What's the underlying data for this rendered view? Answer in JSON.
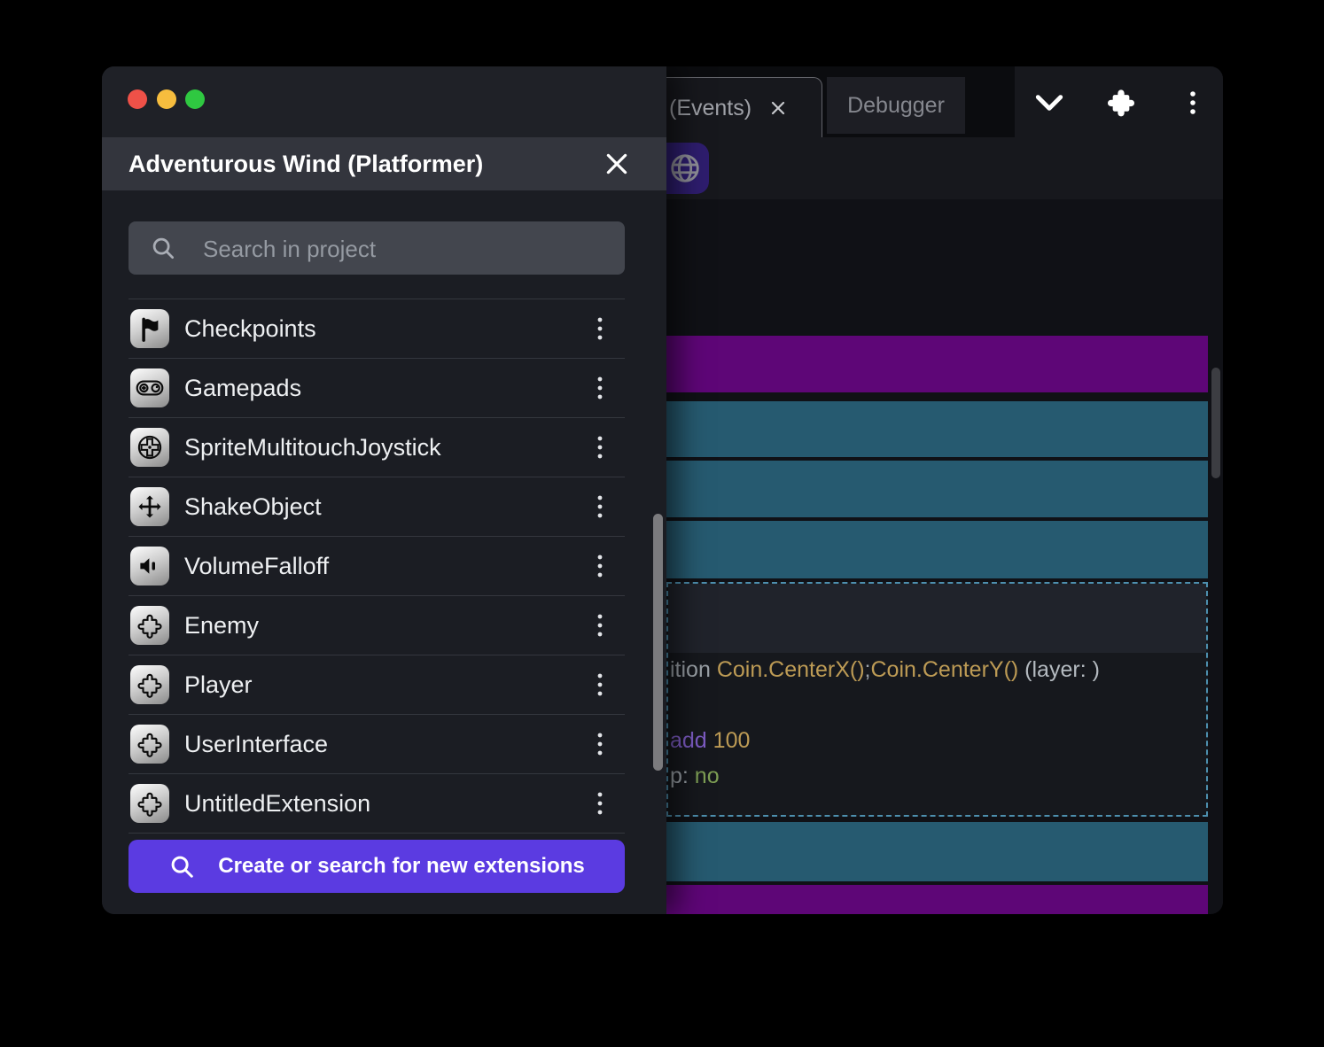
{
  "panel": {
    "title": "Adventurous Wind (Platformer)",
    "search": {
      "placeholder": "Search in project"
    },
    "items": [
      {
        "label": "Checkpoints",
        "icon": "flag-icon"
      },
      {
        "label": "Gamepads",
        "icon": "gamepad-icon"
      },
      {
        "label": "SpriteMultitouchJoystick",
        "icon": "joystick-icon"
      },
      {
        "label": "ShakeObject",
        "icon": "move-arrows-icon"
      },
      {
        "label": "VolumeFalloff",
        "icon": "speaker-icon"
      },
      {
        "label": "Enemy",
        "icon": "puzzle-icon"
      },
      {
        "label": "Player",
        "icon": "puzzle-icon"
      },
      {
        "label": "UserInterface",
        "icon": "puzzle-icon"
      },
      {
        "label": "UntitledExtension",
        "icon": "puzzle-icon"
      }
    ],
    "create_button": {
      "label": "Create or search for new extensions"
    }
  },
  "tabs": [
    {
      "label": "(Events)",
      "active": true,
      "closable": true
    },
    {
      "label": "Debugger",
      "active": false
    }
  ],
  "topbar": {
    "icons": [
      "chevron-down-icon",
      "extensions-puzzle-icon",
      "more-vertical-icon"
    ]
  },
  "toolbar": {
    "icons": [
      "add-event-icon",
      "add-subevent-icon",
      "add-comment-icon",
      "add-circle-icon",
      "trash-icon",
      "undo-icon",
      "redo-icon",
      "search-icon",
      "globe-icon"
    ]
  },
  "events": {
    "rows": [
      "purple",
      "teal",
      "teal",
      "teal",
      "selected",
      "teal",
      "purple",
      "teal"
    ],
    "selected": {
      "line1": [
        {
          "t": "ition ",
          "c": "gray"
        },
        {
          "t": "Coin.CenterX()",
          "c": "gold"
        },
        {
          "t": ";",
          "c": "gray"
        },
        {
          "t": "Coin.CenterY()",
          "c": "gold"
        },
        {
          "t": " (layer: )",
          "c": "light"
        }
      ],
      "line2": [
        {
          "t": "add ",
          "c": "purple"
        },
        {
          "t": "100",
          "c": "gold"
        }
      ],
      "line3": [
        {
          "t": "p: ",
          "c": "gray"
        },
        {
          "t": "no",
          "c": "green"
        }
      ]
    }
  },
  "colors": {
    "event_purple": "#5e0677",
    "event_teal": "#265a70",
    "selection_dash": "#4d8fae",
    "accent_button": "#5b3be1",
    "code_gold": "#bd9b55",
    "code_purple": "#7d5cc4",
    "code_green": "#7d9e54",
    "traffic_red": "#ef5148",
    "traffic_yellow": "#f6bd3e",
    "traffic_green": "#2fc841"
  }
}
